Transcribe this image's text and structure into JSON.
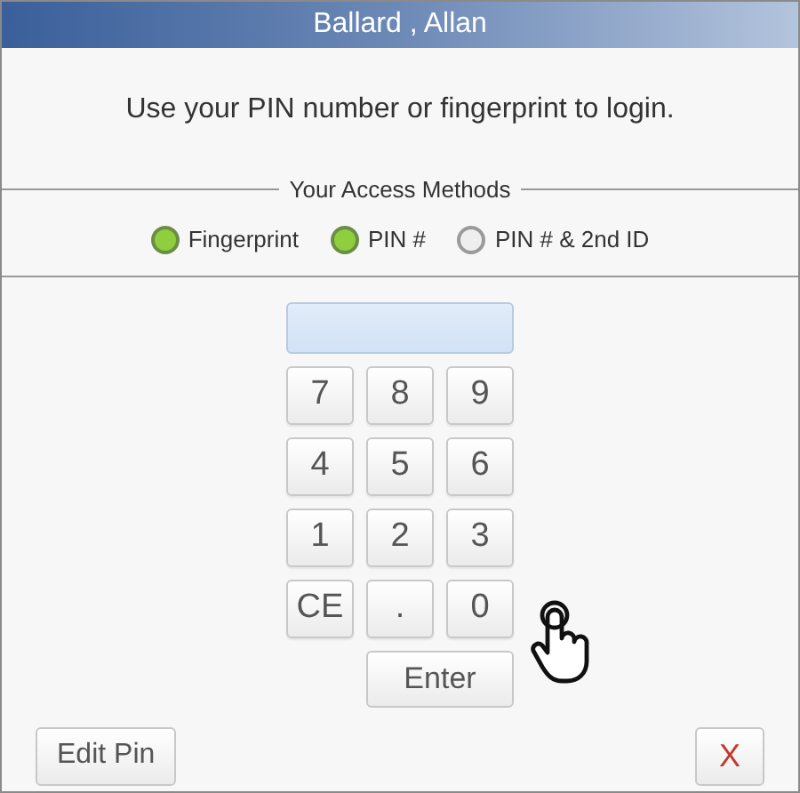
{
  "window": {
    "title": "Ballard , Allan"
  },
  "message": "Use your PIN number or fingerprint to login.",
  "access_methods": {
    "legend": "Your Access Methods",
    "items": [
      {
        "label": "Fingerprint",
        "on": true
      },
      {
        "label": "PIN #",
        "on": true
      },
      {
        "label": "PIN # & 2nd ID",
        "on": false
      }
    ]
  },
  "keypad": {
    "rows": [
      [
        "7",
        "8",
        "9"
      ],
      [
        "4",
        "5",
        "6"
      ],
      [
        "1",
        "2",
        "3"
      ],
      [
        "CE",
        ".",
        "0"
      ]
    ],
    "enter": "Enter"
  },
  "buttons": {
    "edit": "Edit Pin",
    "close": "X"
  }
}
